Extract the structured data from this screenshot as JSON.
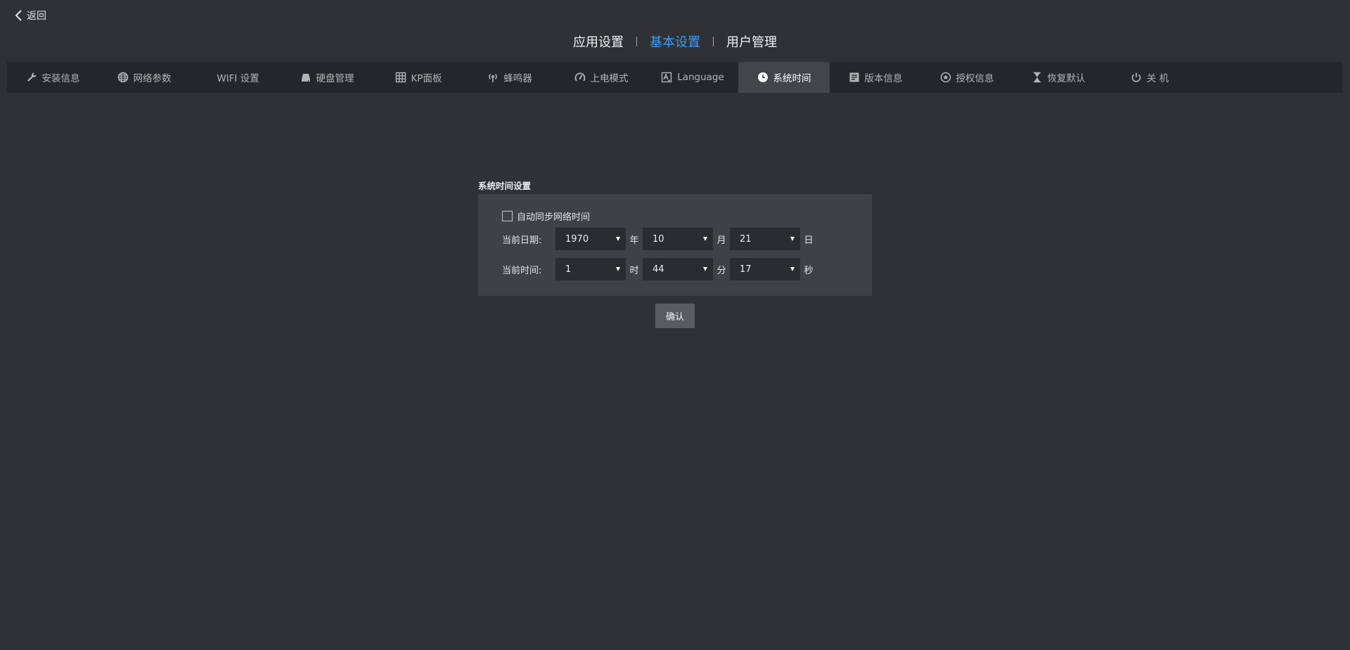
{
  "back": {
    "label": "返回"
  },
  "top_nav": {
    "items": [
      {
        "label": "应用设置",
        "active": false
      },
      {
        "label": "基本设置",
        "active": true
      },
      {
        "label": "用户管理",
        "active": false
      }
    ]
  },
  "tabs": [
    {
      "label": "安装信息",
      "icon": "wrench-icon"
    },
    {
      "label": "网络参数",
      "icon": "globe-icon"
    },
    {
      "label": "WIFI 设置",
      "icon": ""
    },
    {
      "label": "硬盘管理",
      "icon": "hard-disk-icon"
    },
    {
      "label": "KP面板",
      "icon": "grid-panel-icon"
    },
    {
      "label": "蜂鸣器",
      "icon": "buzzer-icon"
    },
    {
      "label": "上电模式",
      "icon": "gauge-icon"
    },
    {
      "label": "Language",
      "icon": "language-icon"
    },
    {
      "label": "系统时间",
      "icon": "clock-icon",
      "active": true
    },
    {
      "label": "版本信息",
      "icon": "document-icon"
    },
    {
      "label": "授权信息",
      "icon": "star-badge-icon"
    },
    {
      "label": "恢复默认",
      "icon": "hourglass-icon"
    },
    {
      "label": "关 机",
      "icon": "power-icon"
    }
  ],
  "system_time": {
    "section_title": "系统时间设置",
    "auto_sync": {
      "label": "自动同步网络时间",
      "checked": false
    },
    "date": {
      "label": "当前日期:",
      "year": "1970",
      "year_unit": "年",
      "month": "10",
      "month_unit": "月",
      "day": "21",
      "day_unit": "日"
    },
    "time": {
      "label": "当前时间:",
      "hour": "1",
      "hour_unit": "时",
      "minute": "44",
      "minute_unit": "分",
      "second": "17",
      "second_unit": "秒"
    },
    "confirm_label": "确认"
  },
  "colors": {
    "background": "#303136",
    "tab_bar": "#25262b",
    "tab_active": "#43454b",
    "accent": "#3a9cf5",
    "panel": "#404146",
    "select_bg": "#2b2c31",
    "button": "#5b5c61"
  }
}
